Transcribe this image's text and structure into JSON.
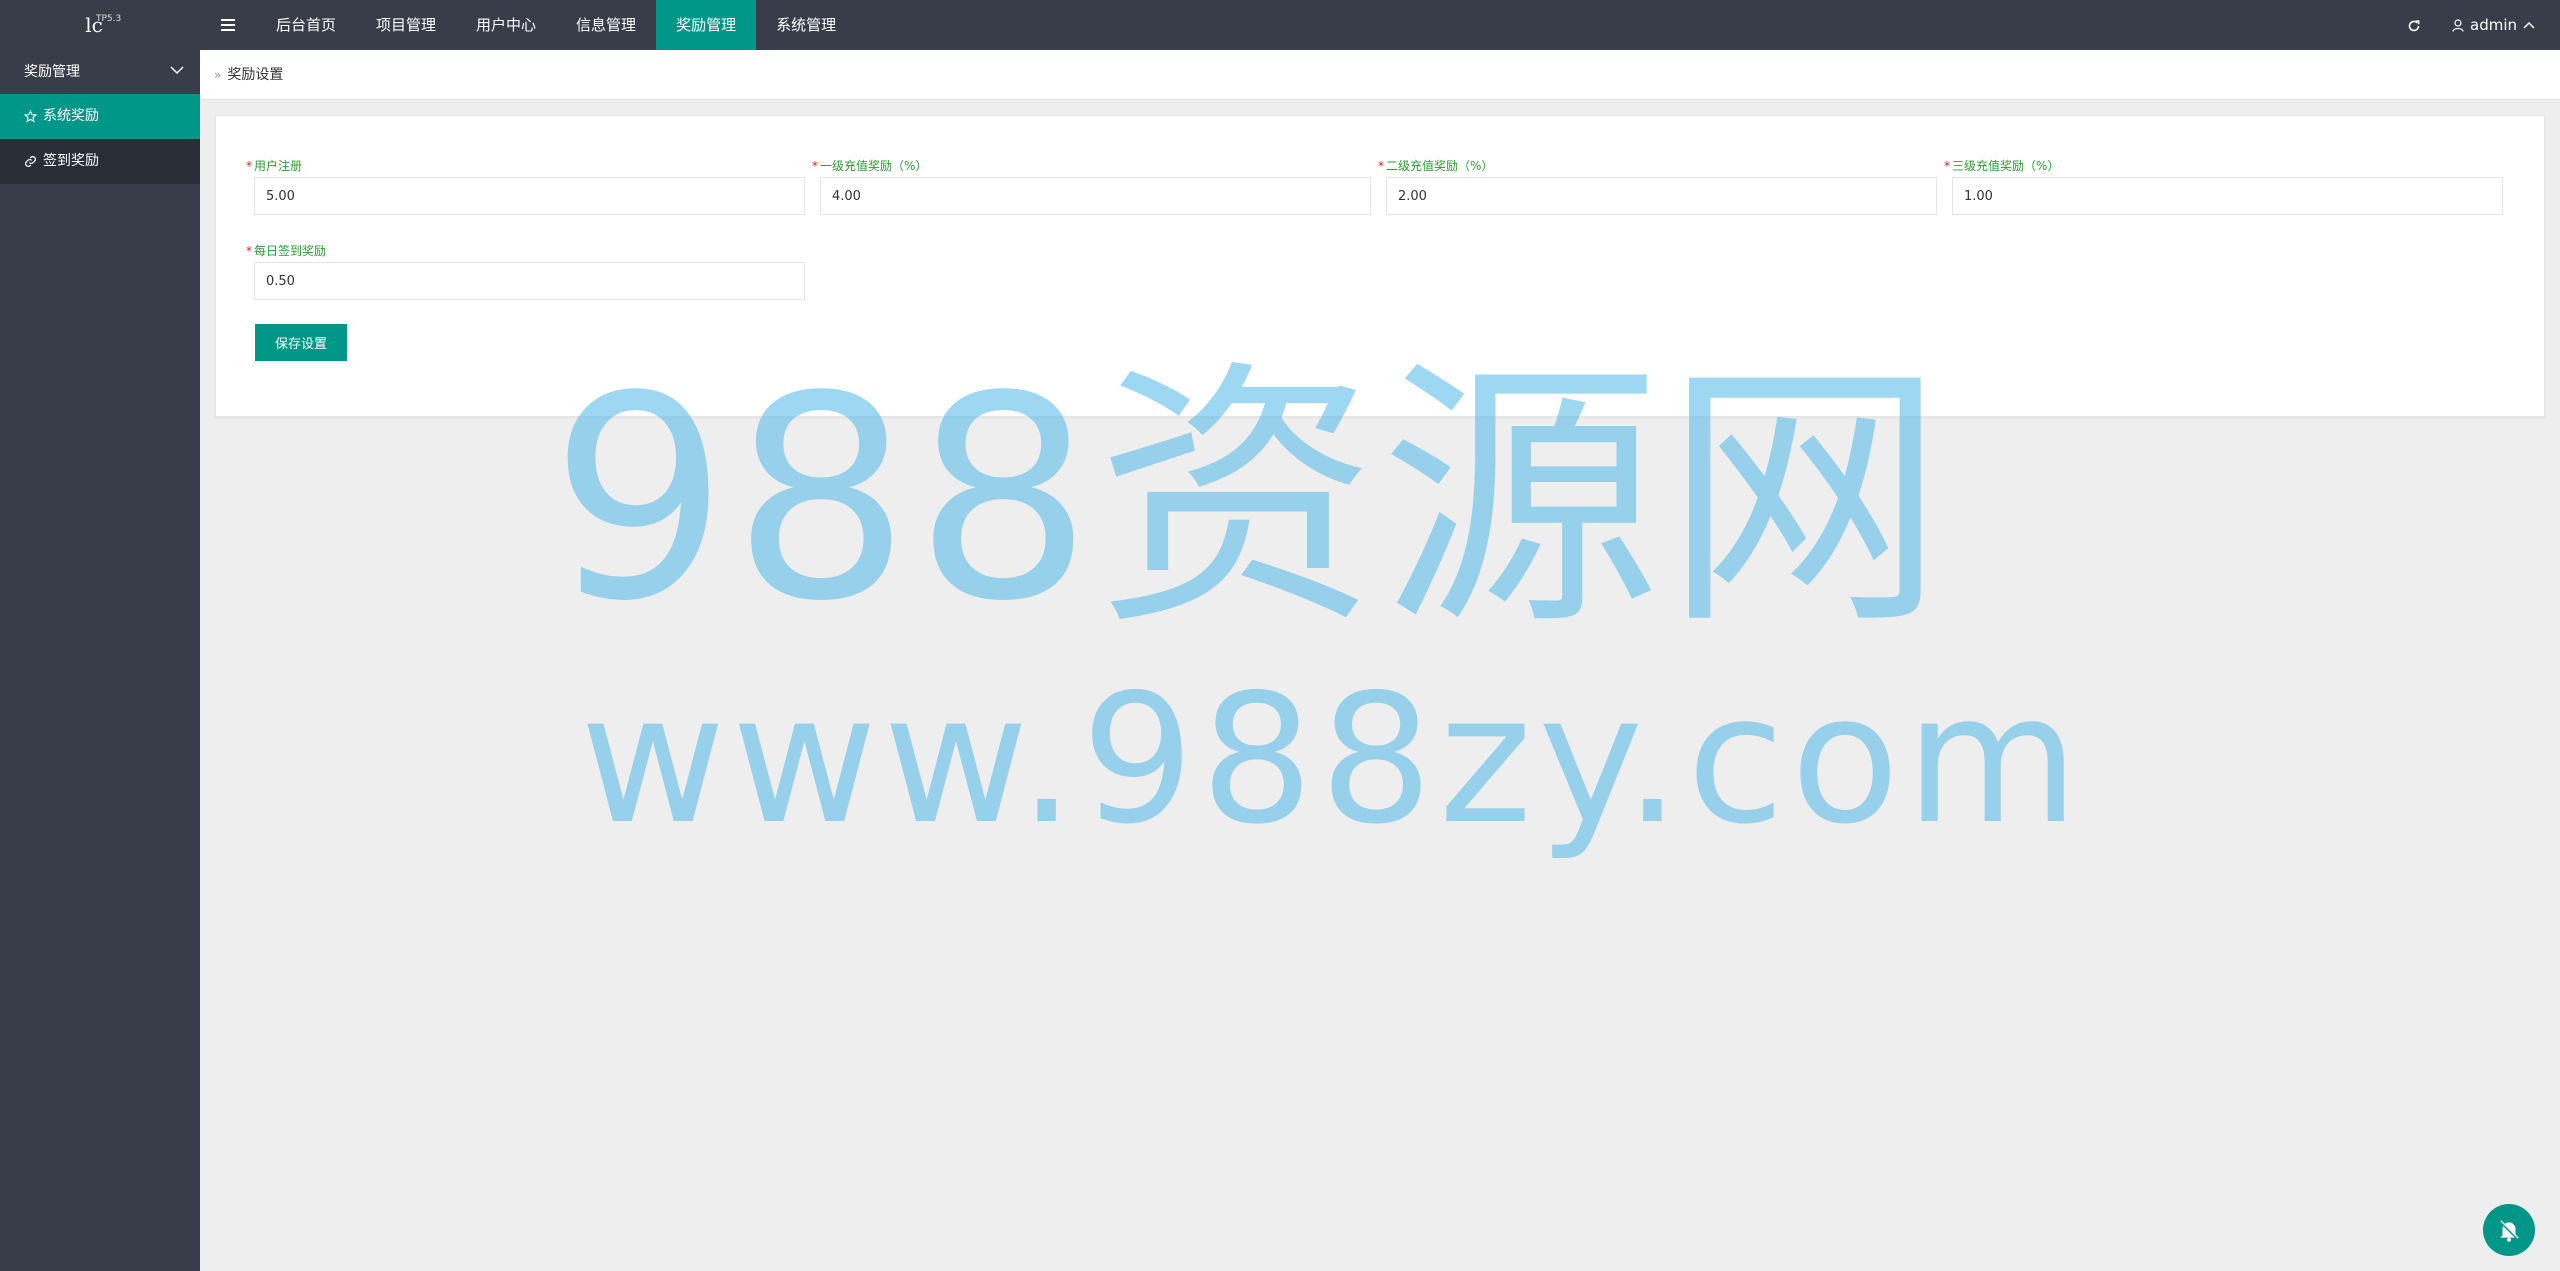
{
  "header": {
    "logo_text": "lc",
    "logo_version": "TP5.3",
    "menu_toggle_icon": "hamburger-icon",
    "nav": [
      {
        "label": "后台首页",
        "active": false
      },
      {
        "label": "项目管理",
        "active": false
      },
      {
        "label": "用户中心",
        "active": false
      },
      {
        "label": "信息管理",
        "active": false
      },
      {
        "label": "奖励管理",
        "active": true
      },
      {
        "label": "系统管理",
        "active": false
      }
    ],
    "refresh_icon": "refresh-icon",
    "user_name": "admin"
  },
  "sidebar": {
    "group_label": "奖励管理",
    "items": [
      {
        "label": "系统奖励",
        "icon": "star-icon",
        "active": true
      },
      {
        "label": "签到奖励",
        "icon": "link-icon",
        "active": false
      }
    ]
  },
  "breadcrumb": {
    "current": "奖励设置"
  },
  "form": {
    "fields": [
      {
        "label": "用户注册",
        "value": "5.00"
      },
      {
        "label": "一级充值奖励（%）",
        "value": "4.00"
      },
      {
        "label": "二级充值奖励（%）",
        "value": "2.00"
      },
      {
        "label": "三级充值奖励（%）",
        "value": "1.00"
      },
      {
        "label": "每日签到奖励",
        "value": "0.50"
      }
    ],
    "save_label": "保存设置"
  },
  "watermark": {
    "line1": "988资源网",
    "line2": "www.988zy.com"
  },
  "colors": {
    "accent": "#009688",
    "topbar": "#393d49",
    "label_green": "#2e9a35",
    "required_red": "#e02020"
  }
}
